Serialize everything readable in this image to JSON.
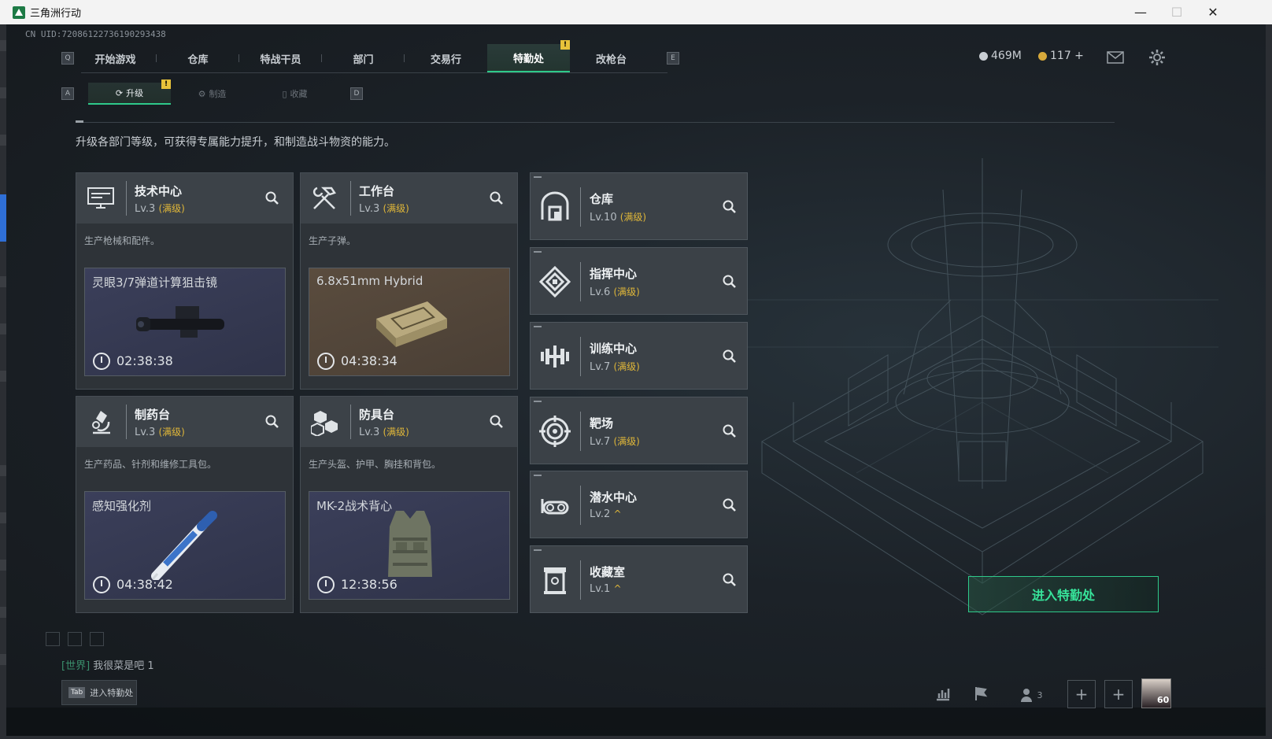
{
  "window": {
    "title": "三角洲行动",
    "controls": [
      "—",
      "☐",
      "✕"
    ]
  },
  "uid": "CN UID:72086122736190293438",
  "topnav": {
    "key_left": "Q",
    "key_right": "E",
    "tabs": [
      {
        "label": "开始游戏"
      },
      {
        "label": "仓库"
      },
      {
        "label": "特战干员"
      },
      {
        "label": "部门"
      },
      {
        "label": "交易行"
      },
      {
        "label": "特勤处",
        "active": true,
        "alert": "!"
      },
      {
        "label": "改枪台"
      }
    ]
  },
  "currency": {
    "coins": "469M",
    "bonds": "117 +"
  },
  "subnav": {
    "key_left": "A",
    "key_right": "D",
    "tabs": [
      {
        "label": "升级",
        "active": true,
        "alert": "!"
      },
      {
        "label": "制造"
      },
      {
        "label": "收藏"
      }
    ]
  },
  "description": "升级各部门等级，可获得专属能力提升，和制造战斗物资的能力。",
  "workshops": [
    {
      "name": "技术中心",
      "level": "Lv.3",
      "max_label": "(满级)",
      "produces": "生产枪械和配件。",
      "item": "灵眼3/7弹道计算狙击镜",
      "timer": "02:38:38",
      "icon": "monitor-icon"
    },
    {
      "name": "工作台",
      "level": "Lv.3",
      "max_label": "(满级)",
      "produces": "生产子弹。",
      "item": "6.8x51mm Hybrid",
      "timer": "04:38:34",
      "icon": "hammer-wrench-icon"
    },
    {
      "name": "制药台",
      "level": "Lv.3",
      "max_label": "(满级)",
      "produces": "生产药品、针剂和维修工具包。",
      "item": "感知强化剂",
      "timer": "04:38:42",
      "icon": "microscope-icon"
    },
    {
      "name": "防具台",
      "level": "Lv.3",
      "max_label": "(满级)",
      "produces": "生产头盔、护甲、胸挂和背包。",
      "item": "MK-2战术背心",
      "timer": "12:38:56",
      "icon": "armor-blocks-icon"
    }
  ],
  "facilities": [
    {
      "name": "仓库",
      "level": "Lv.10",
      "max_label": "(满级)",
      "icon": "warehouse-icon"
    },
    {
      "name": "指挥中心",
      "level": "Lv.6",
      "max_label": "(满级)",
      "icon": "command-center-icon"
    },
    {
      "name": "训练中心",
      "level": "Lv.7",
      "max_label": "(满级)",
      "icon": "dumbbell-icon"
    },
    {
      "name": "靶场",
      "level": "Lv.7",
      "max_label": "(满级)",
      "icon": "target-icon"
    },
    {
      "name": "潜水中心",
      "level": "Lv.2",
      "upgrade": "^",
      "icon": "diving-goggles-icon"
    },
    {
      "name": "收藏室",
      "level": "Lv.1",
      "upgrade": "^",
      "icon": "collection-icon"
    }
  ],
  "enter_button": "进入特勤处",
  "chat": {
    "channel": "[世界]",
    "message": "我很菜是吧  1"
  },
  "tab_hint": {
    "key": "Tab",
    "label": "进入特勤处"
  },
  "bottom": {
    "friends_count": "3",
    "avatar_level": "60"
  },
  "colors": {
    "accent": "#2ec98a",
    "alert": "#e7c23a",
    "max_level": "#e0b739"
  }
}
